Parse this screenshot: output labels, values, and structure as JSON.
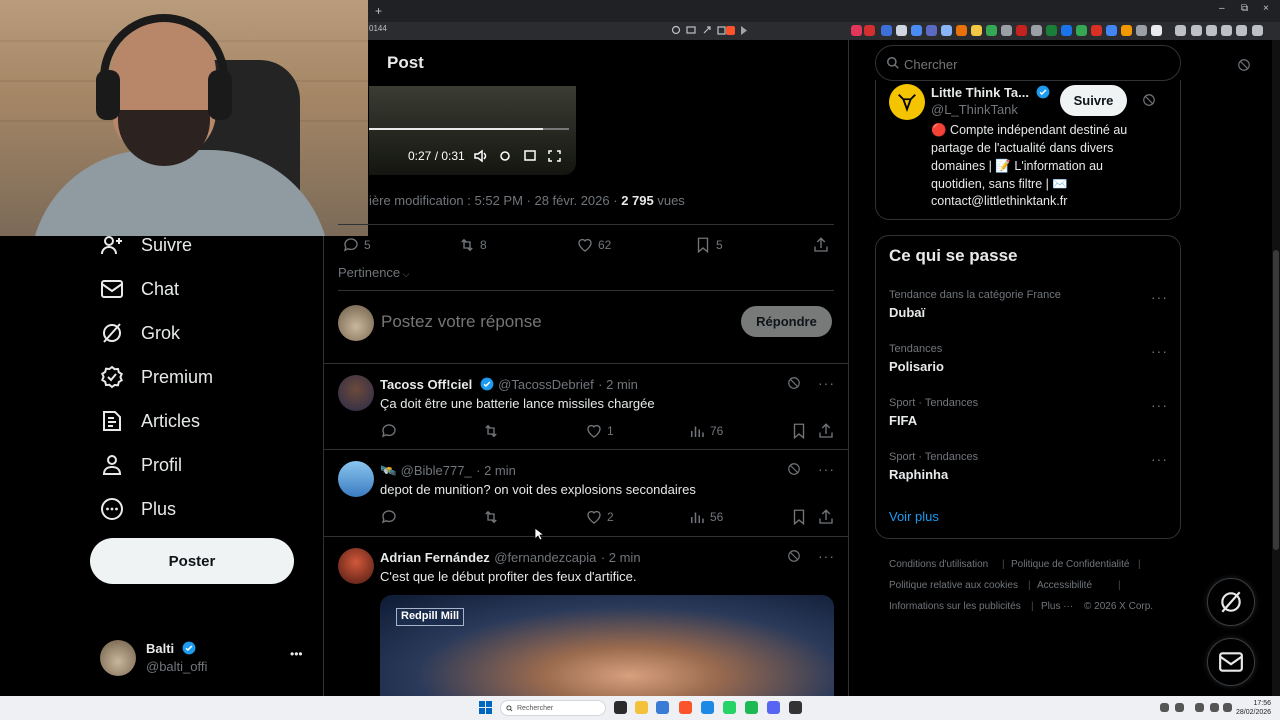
{
  "browser": {
    "url_fragment": "0144",
    "new_tab_symbol": "+",
    "tab_close_symbol": "×",
    "window_controls": [
      "–",
      "⧉",
      "×"
    ]
  },
  "colors": {
    "background": "#000000",
    "text_primary": "#e7e9ea",
    "text_secondary": "#71767b",
    "border": "#2f3336",
    "verified_blue": "#1d9bf0",
    "like_gray": "#71767b"
  },
  "nav": {
    "items": [
      {
        "label": "Suivre",
        "icon": "add-user-icon"
      },
      {
        "label": "Chat",
        "icon": "mail-icon"
      },
      {
        "label": "Grok",
        "icon": "grok-icon"
      },
      {
        "label": "Premium",
        "icon": "premium-icon"
      },
      {
        "label": "Articles",
        "icon": "articles-icon"
      },
      {
        "label": "Profil",
        "icon": "profile-icon"
      },
      {
        "label": "Plus",
        "icon": "more-circle-icon"
      }
    ],
    "post_button": "Poster",
    "account": {
      "name": "Balti",
      "handle": "@balti_offi",
      "more": "•••"
    }
  },
  "post": {
    "header_title": "Post",
    "video": {
      "time": "0:27 / 0:31",
      "progress": 0.87
    },
    "meta": {
      "prefix": "ière modification : 5:52 PM · 28 févr. 2026 · ",
      "views_count": "2 795",
      "views_label": " vues"
    },
    "actions": {
      "replies": "5",
      "reposts": "8",
      "likes": "62",
      "bookmarks": "5"
    },
    "sort_label": "Pertinence",
    "reply_placeholder": "Postez votre réponse",
    "reply_button": "Répondre"
  },
  "replies": [
    {
      "name": "Tacoss Off!ciel",
      "verified": true,
      "handle": "@TacossDebrief",
      "time": "· 2 min",
      "text": "Ça doit être une batterie lance missiles chargée",
      "replies": "",
      "reposts": "",
      "likes": "1",
      "views": "76"
    },
    {
      "name": "🛰️",
      "verified": false,
      "handle": "@Bible777_",
      "time": "· 2 min",
      "text": "depot de munition? on voit des explosions secondaires",
      "replies": "",
      "reposts": "",
      "likes": "2",
      "views": "56"
    },
    {
      "name": "Adrian Fernández",
      "verified": false,
      "handle": "@fernandezcapia",
      "time": "· 2 min",
      "text": "C'est que le début profiter des feux d'artifice.",
      "media_logo": "Redpill Mill"
    }
  ],
  "search": {
    "placeholder": "Chercher"
  },
  "follow_card": {
    "name": "Little Think Ta...",
    "handle": "@L_ThinkTank",
    "follow_label": "Suivre",
    "bio": [
      "🔴 Compte indépendant destiné au",
      "partage de l'actualité dans divers",
      "domaines | 📝 L'information au",
      "quotidien, sans filtre | ✉️",
      "contact@littlethinktank.fr"
    ]
  },
  "trends": {
    "title": "Ce qui se passe",
    "items": [
      {
        "meta": "Tendance dans la catégorie France",
        "name": "Dubaï"
      },
      {
        "meta": "Tendances",
        "name": "Polisario"
      },
      {
        "meta": "Sport · Tendances",
        "name": "FIFA"
      },
      {
        "meta": "Sport · Tendances",
        "name": "Raphinha"
      }
    ],
    "show_more": "Voir plus"
  },
  "footer": {
    "links": [
      "Conditions d'utilisation",
      "Politique de Confidentialité",
      "Politique relative aux cookies",
      "Accessibilité",
      "Informations sur les publicités",
      "Plus ···",
      "© 2026 X Corp."
    ]
  },
  "taskbar": {
    "search_placeholder": "Rechercher",
    "time": "17:56",
    "date": "28/02/2026"
  }
}
